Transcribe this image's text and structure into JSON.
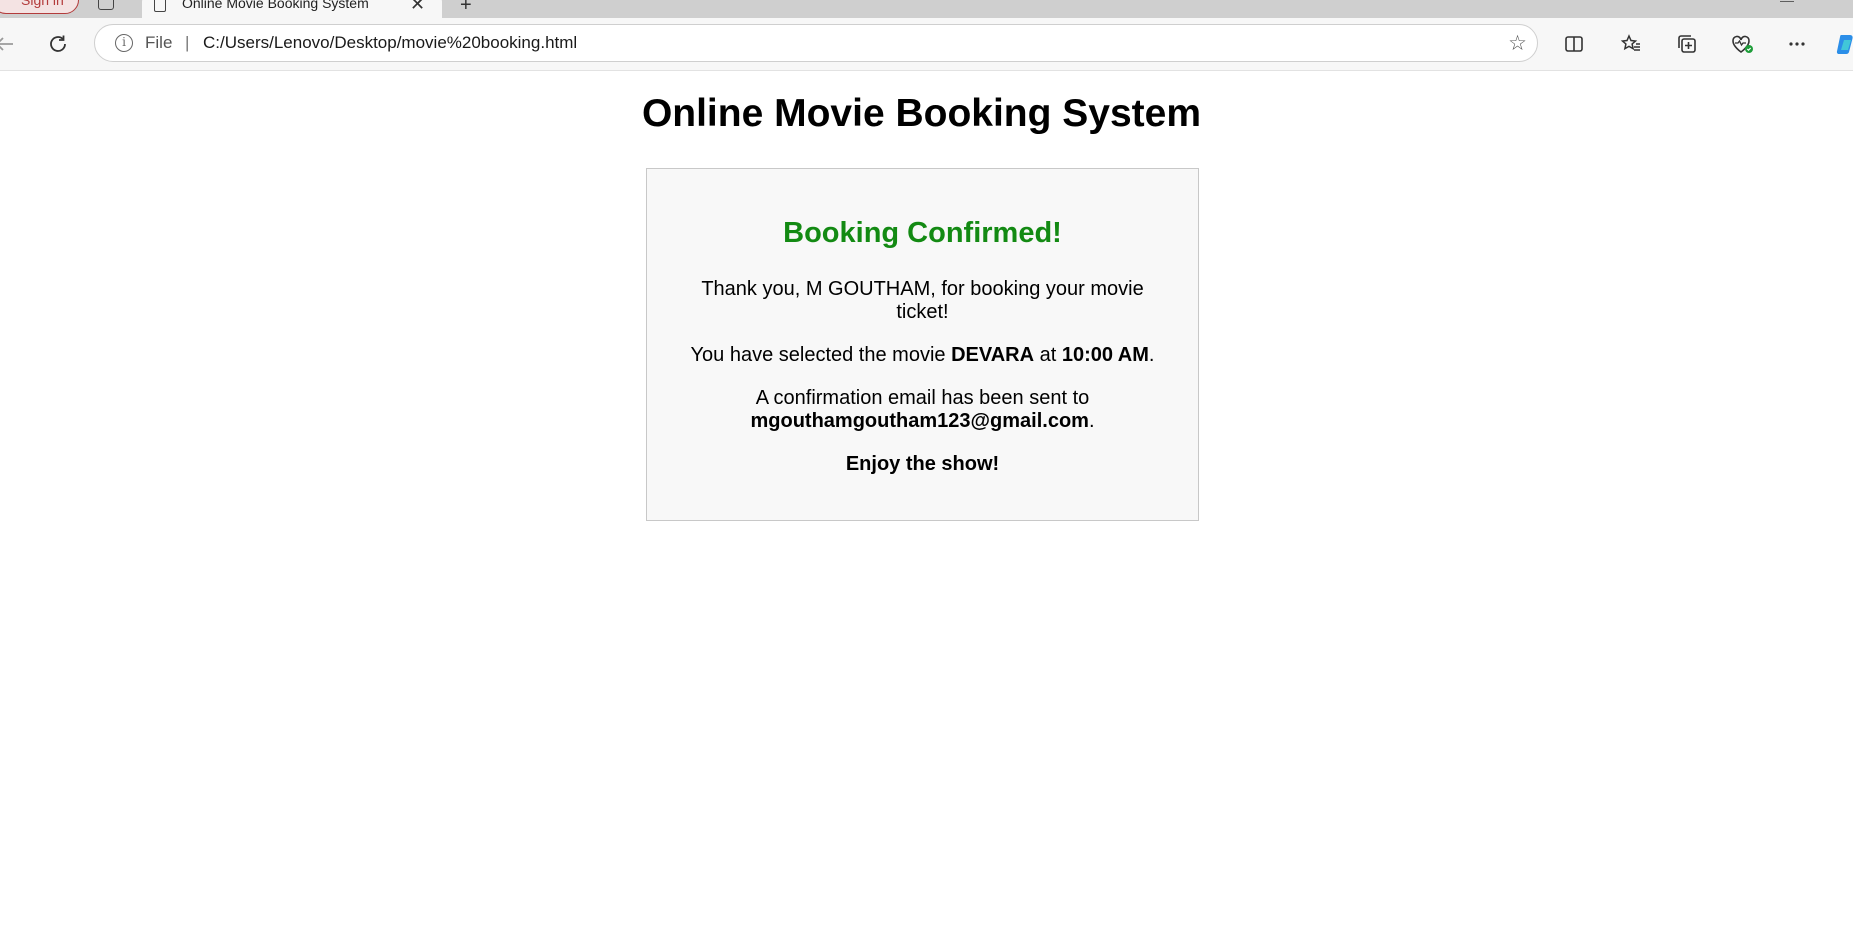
{
  "browser": {
    "signin_label": "Sign in",
    "tab_title": "Online Movie Booking System",
    "close_glyph": "✕",
    "newtab_glyph": "+",
    "minimize_glyph": "—",
    "address_scheme": "File",
    "address_url": "C:/Users/Lenovo/Desktop/movie%20booking.html",
    "icons": [
      "back-icon",
      "refresh-icon",
      "info-icon",
      "star-icon",
      "split-screen-icon",
      "favorites-icon",
      "collections-icon",
      "browser-essentials-icon",
      "more-icon",
      "copilot-icon"
    ]
  },
  "page": {
    "title": "Online Movie Booking System",
    "confirmation": {
      "heading": "Booking Confirmed!",
      "heading_color": "#138a13",
      "thanks_text": "Thank you, M GOUTHAM, for booking your movie ticket!",
      "selected_prefix": "You have selected the movie ",
      "movie": "DEVARA",
      "at_text": " at ",
      "time": "10:00 AM",
      "selected_suffix": ".",
      "email_prefix": "A confirmation email has been sent to ",
      "email": "mgouthamgoutham123@gmail.com",
      "email_suffix": ".",
      "closing": "Enjoy the show!"
    }
  }
}
